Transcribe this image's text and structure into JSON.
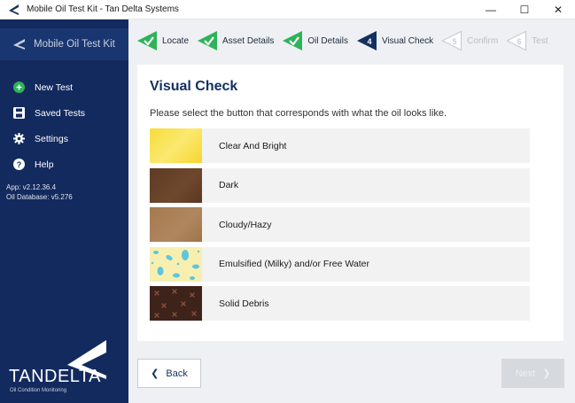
{
  "window": {
    "title": "Mobile Oil Test Kit - Tan Delta Systems",
    "minimize": "—",
    "maximize": "☐",
    "close": "✕"
  },
  "sidebar": {
    "brand": "Mobile Oil Test Kit",
    "items": [
      {
        "label": "New Test",
        "icon": "plus-circle-icon"
      },
      {
        "label": "Saved Tests",
        "icon": "save-icon"
      },
      {
        "label": "Settings",
        "icon": "gear-icon"
      },
      {
        "label": "Help",
        "icon": "help-icon"
      }
    ],
    "version_app": "App: v2.12.36.4",
    "version_db": "Oil Database: v5.276",
    "logo_word": "TANDELTA",
    "logo_sub": "Oil Condition Monitoring"
  },
  "steps": [
    {
      "label": "Locate",
      "state": "done"
    },
    {
      "label": "Asset Details",
      "state": "done"
    },
    {
      "label": "Oil Details",
      "state": "done"
    },
    {
      "label": "Visual Check",
      "state": "current",
      "number": "4"
    },
    {
      "label": "Confirm",
      "state": "pending",
      "number": "5"
    },
    {
      "label": "Test",
      "state": "pending",
      "number": "6"
    }
  ],
  "colors": {
    "sidebar_bg": "#132a5e",
    "step_done": "#2db35a",
    "step_current": "#13305e",
    "step_pending": "#c9cdd4"
  },
  "card": {
    "title": "Visual Check",
    "instruction": "Please select the button that corresponds with what the oil looks like.",
    "options": [
      {
        "label": "Clear And Bright"
      },
      {
        "label": "Dark"
      },
      {
        "label": "Cloudy/Hazy"
      },
      {
        "label": "Emulsified (Milky) and/or Free Water"
      },
      {
        "label": "Solid Debris"
      }
    ]
  },
  "nav": {
    "back_label": "Back",
    "next_label": "Next"
  }
}
